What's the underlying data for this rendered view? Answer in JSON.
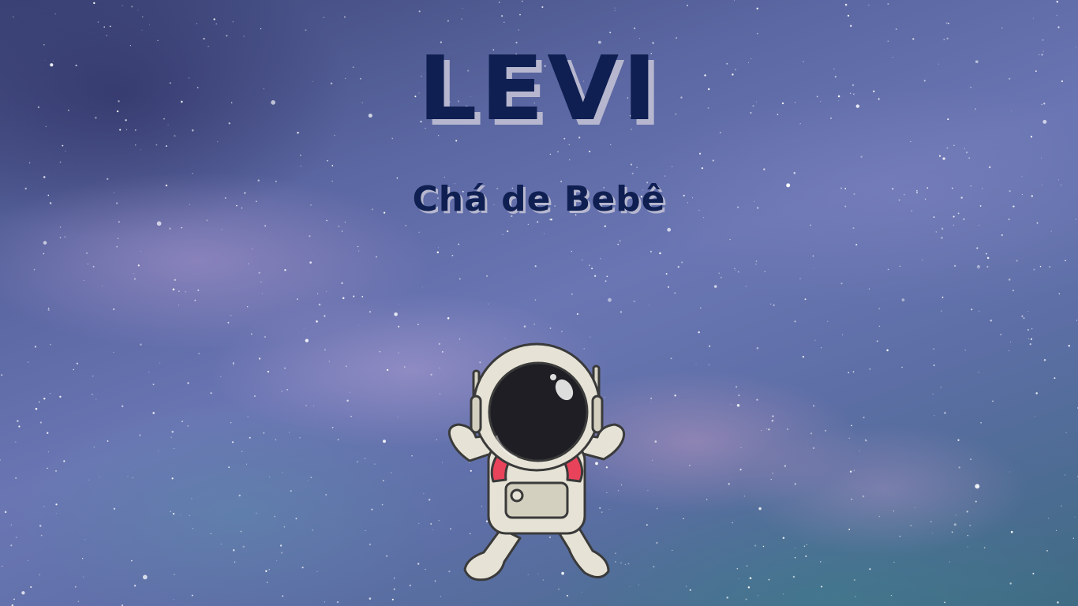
{
  "card": {
    "title": "LEVI",
    "subtitle": "Chá de Bebê"
  },
  "colors": {
    "text": "#0f1f52",
    "text_shadow": "#b6b7cf",
    "sky_top": "#3c4577",
    "sky_mid": "#6a76b3",
    "sky_bottom": "#3f6b83",
    "suit": "#e6e3d6",
    "visor": "#1e1e24",
    "backpack_strap": "#e8435a"
  },
  "icons": {
    "illustration": "astronaut-icon",
    "background": "starfield"
  }
}
